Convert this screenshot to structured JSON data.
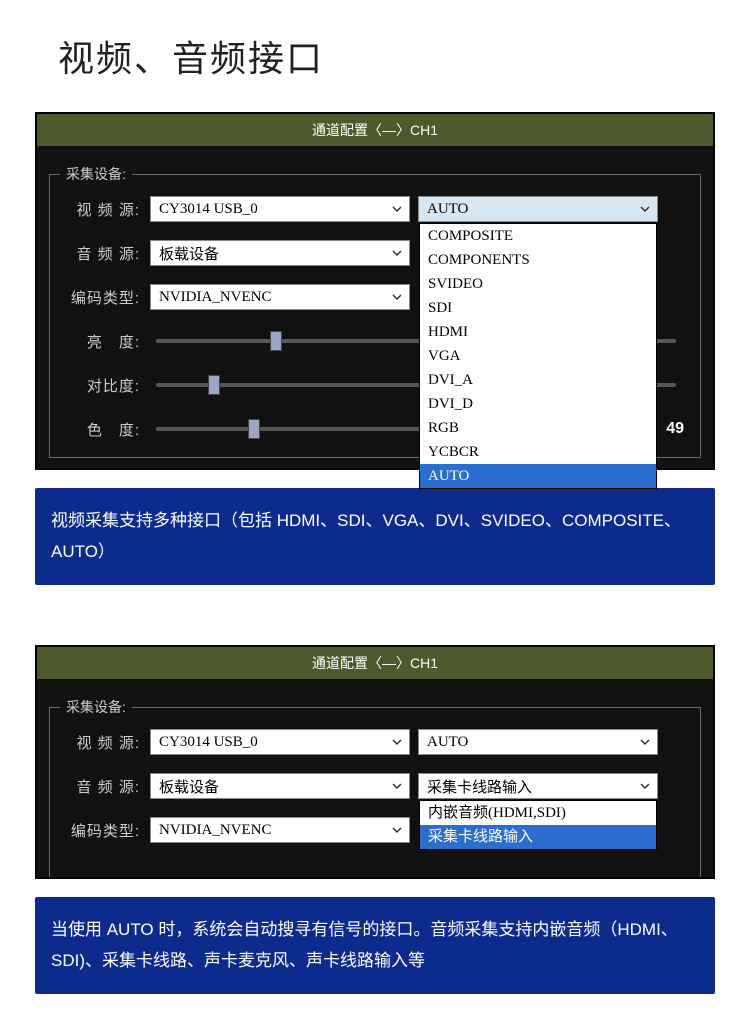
{
  "page_title": "视频、音频接口",
  "titlebar": "通道配置〈—〉CH1",
  "legend": "采集设备:",
  "labels": {
    "video_src": "视 频 源:",
    "audio_src": "音 频 源:",
    "enc_type": "编码类型:",
    "brightness": "亮　度:",
    "contrast": "对比度:",
    "hue": "色　度:"
  },
  "combos": {
    "video_src": "CY3014 USB_0",
    "audio_src": "板载设备",
    "enc_type": "NVIDIA_NVENC",
    "video_in": "AUTO",
    "audio_in_sel": "采集卡线路输入"
  },
  "video_in_options": [
    "COMPOSITE",
    "COMPONENTS",
    "SVIDEO",
    "SDI",
    "HDMI",
    "VGA",
    "DVI_A",
    "DVI_D",
    "RGB",
    "YCBCR",
    "AUTO"
  ],
  "audio_in_options": [
    "内嵌音频(HDMI,SDI)",
    "采集卡线路输入"
  ],
  "hue_value": "49",
  "caption1": "视频采集支持多种接口（包括 HDMI、SDI、VGA、DVI、SVIDEO、COMPOSITE、AUTO）",
  "caption2": "当使用 AUTO 时，系统会自动搜寻有信号的接口。音频采集支持内嵌音频（HDMI、SDI)、采集卡线路、声卡麦克风、声卡线路输入等"
}
